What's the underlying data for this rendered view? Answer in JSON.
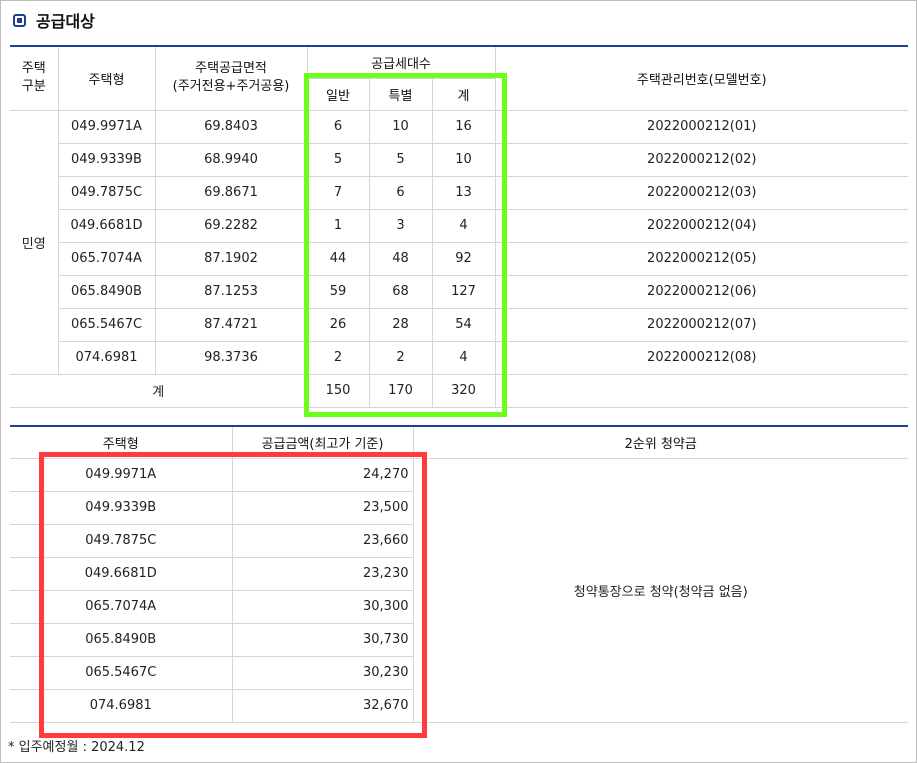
{
  "title": "공급대상",
  "supply_table": {
    "headers": {
      "house_type_div": "주택\n구분",
      "house_type": "주택형",
      "area": "주택공급면적\n(주거전용+주거공용)",
      "units": "공급세대수",
      "general": "일반",
      "special": "특별",
      "total": "계",
      "model_no": "주택관리번호(모델번호)"
    },
    "category": "민영",
    "rows": [
      {
        "type": "049.9971A",
        "area": "69.8403",
        "general": "6",
        "special": "10",
        "total": "16",
        "model": "2022000212(01)"
      },
      {
        "type": "049.9339B",
        "area": "68.9940",
        "general": "5",
        "special": "5",
        "total": "10",
        "model": "2022000212(02)"
      },
      {
        "type": "049.7875C",
        "area": "69.8671",
        "general": "7",
        "special": "6",
        "total": "13",
        "model": "2022000212(03)"
      },
      {
        "type": "049.6681D",
        "area": "69.2282",
        "general": "1",
        "special": "3",
        "total": "4",
        "model": "2022000212(04)"
      },
      {
        "type": "065.7074A",
        "area": "87.1902",
        "general": "44",
        "special": "48",
        "total": "92",
        "model": "2022000212(05)"
      },
      {
        "type": "065.8490B",
        "area": "87.1253",
        "general": "59",
        "special": "68",
        "total": "127",
        "model": "2022000212(06)"
      },
      {
        "type": "065.5467C",
        "area": "87.4721",
        "general": "26",
        "special": "28",
        "total": "54",
        "model": "2022000212(07)"
      },
      {
        "type": "074.6981",
        "area": "98.3736",
        "general": "2",
        "special": "2",
        "total": "4",
        "model": "2022000212(08)"
      }
    ],
    "sum": {
      "label": "계",
      "general": "150",
      "special": "170",
      "total": "320"
    }
  },
  "price_table": {
    "headers": {
      "house_type": "주택형",
      "price": "공급금액(최고가 기준)",
      "deposit": "2순위 청약금"
    },
    "deposit_note": "청약통장으로 청약(청약금 없음)",
    "rows": [
      {
        "type": "049.9971A",
        "price": "24,270"
      },
      {
        "type": "049.9339B",
        "price": "23,500"
      },
      {
        "type": "049.7875C",
        "price": "23,660"
      },
      {
        "type": "049.6681D",
        "price": "23,230"
      },
      {
        "type": "065.7074A",
        "price": "30,300"
      },
      {
        "type": "065.8490B",
        "price": "30,730"
      },
      {
        "type": "065.5467C",
        "price": "30,230"
      },
      {
        "type": "074.6981",
        "price": "32,670"
      }
    ]
  },
  "footnote": "* 입주예정월 : 2024.12",
  "highlight_colors": {
    "green": "#6cff1a",
    "red": "#ff3b3b",
    "accent": "#1d3f95"
  }
}
